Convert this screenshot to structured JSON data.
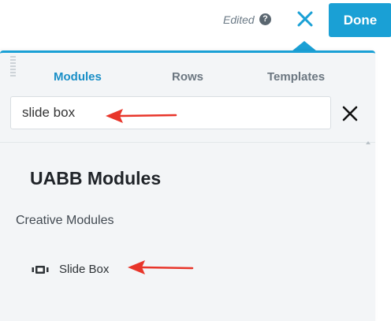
{
  "header": {
    "status_text": "Edited",
    "help_icon": "?",
    "done_label": "Done",
    "accent_color": "#1aa0d5"
  },
  "panel": {
    "tabs": [
      {
        "label": "Modules",
        "active": true
      },
      {
        "label": "Rows",
        "active": false
      },
      {
        "label": "Templates",
        "active": false
      }
    ],
    "search": {
      "value": "slide box"
    },
    "section_title": "UABB Modules",
    "groups": [
      {
        "title": "Creative Modules",
        "items": [
          {
            "label": "Slide Box",
            "icon": "slider-icon"
          }
        ]
      }
    ]
  },
  "annotations": {
    "arrow_color": "#e8352a"
  }
}
